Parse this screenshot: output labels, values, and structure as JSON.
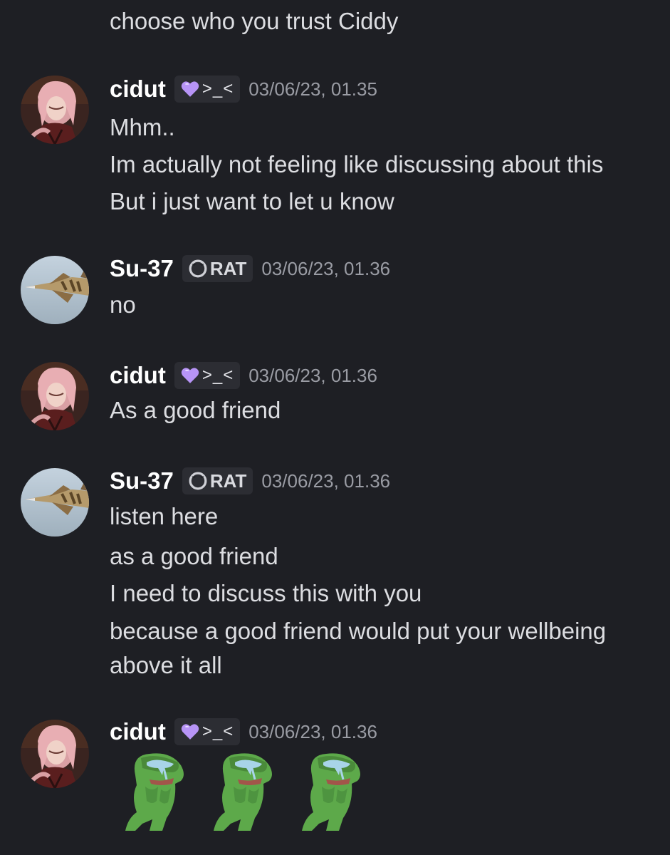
{
  "top_line": "choose who you trust Ciddy",
  "messages": [
    {
      "author": "cidut",
      "tag": ">_<",
      "timestamp": "03/06/23, 01.35",
      "avatar": "pink-haired-character-avatar",
      "lines": [
        "Mhm..",
        "Im actually not feeling like discussing about this",
        "But i just want to let u know"
      ]
    },
    {
      "author": "Su-37",
      "tag": "RAT",
      "timestamp": "03/06/23, 01.36",
      "avatar": "fighter-jet-avatar",
      "lines": [
        "no"
      ]
    },
    {
      "author": "cidut",
      "tag": ">_<",
      "timestamp": "03/06/23, 01.36",
      "avatar": "pink-haired-character-avatar",
      "lines": [
        "As a good friend"
      ]
    },
    {
      "author": "Su-37",
      "tag": "RAT",
      "timestamp": "03/06/23, 01.36",
      "avatar": "fighter-jet-avatar",
      "lines": [
        "listen here",
        "as a good friend",
        "I need to discuss this with you",
        "because a good friend would put your wellbeing",
        "above it all"
      ]
    },
    {
      "author": "cidut",
      "tag": ">_<",
      "timestamp": "03/06/23, 01.36",
      "avatar": "pink-haired-character-avatar",
      "stickers": [
        "crying-frog-sticker",
        "crying-frog-sticker",
        "crying-frog-sticker"
      ]
    }
  ],
  "colors": {
    "background": "#1e1f24",
    "text": "#dcdde1",
    "username": "#ffffff",
    "timestamp": "#9a9ca4",
    "tag_background": "#2c2d33",
    "heart": "#b794f6"
  }
}
